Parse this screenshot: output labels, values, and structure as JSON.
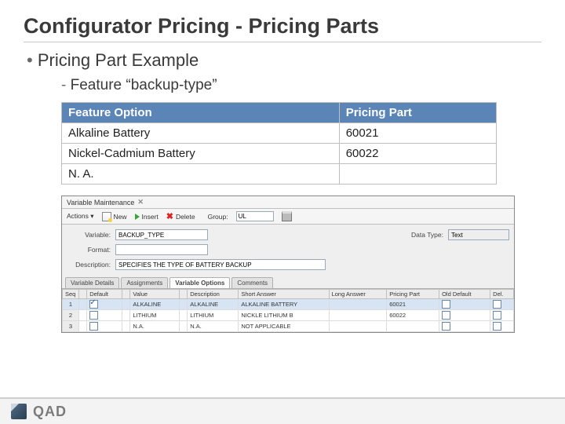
{
  "title": "Configurator Pricing - Pricing Parts",
  "bullet1": "Pricing Part Example",
  "bullet2": "Feature “backup-type”",
  "feat_table": {
    "headers": [
      "Feature Option",
      "Pricing Part"
    ],
    "rows": [
      [
        "Alkaline Battery",
        "60021"
      ],
      [
        "Nickel-Cadmium Battery",
        "60022"
      ],
      [
        "N. A.",
        ""
      ]
    ]
  },
  "screenshot": {
    "window_title": "Variable Maintenance",
    "toolbar": {
      "new": "New",
      "insert": "Insert",
      "delete": "Delete",
      "group": "Group:",
      "group_value": "UL",
      "print_icon": "print"
    },
    "form": {
      "variable_label": "Variable:",
      "variable_value": "BACKUP_TYPE",
      "datatype_label": "Data Type:",
      "datatype_value": "Text",
      "format_label": "Format:",
      "format_value": "",
      "desc_label": "Description:",
      "desc_value": "SPECIFIES THE TYPE OF BATTERY BACKUP"
    },
    "tabs": [
      "Variable Details",
      "Assignments",
      "Variable Options",
      "Comments"
    ],
    "active_tab": 2,
    "grid_headers": [
      "Seq",
      "",
      "Default",
      "",
      "Value",
      "",
      "Description",
      "Short Answer",
      "Long Answer",
      "Pricing Part",
      "Old Default",
      "Del."
    ],
    "grid_rows": [
      {
        "seq": "1",
        "default": true,
        "value": "ALKALINE",
        "desc": "ALKALINE",
        "short": "ALKALINE BATTERY",
        "pp": "60021",
        "old": false,
        "del": false,
        "sel": true
      },
      {
        "seq": "2",
        "default": false,
        "value": "LITHIUM",
        "desc": "LITHIUM",
        "short": "NICKLE LITHIUM B",
        "pp": "60022",
        "old": false,
        "del": false,
        "sel": false
      },
      {
        "seq": "3",
        "default": false,
        "value": "N.A.",
        "desc": "N.A.",
        "short": "NOT APPLICABLE",
        "pp": "",
        "old": false,
        "del": false,
        "sel": false
      }
    ]
  },
  "footer": {
    "brand": "QAD"
  }
}
